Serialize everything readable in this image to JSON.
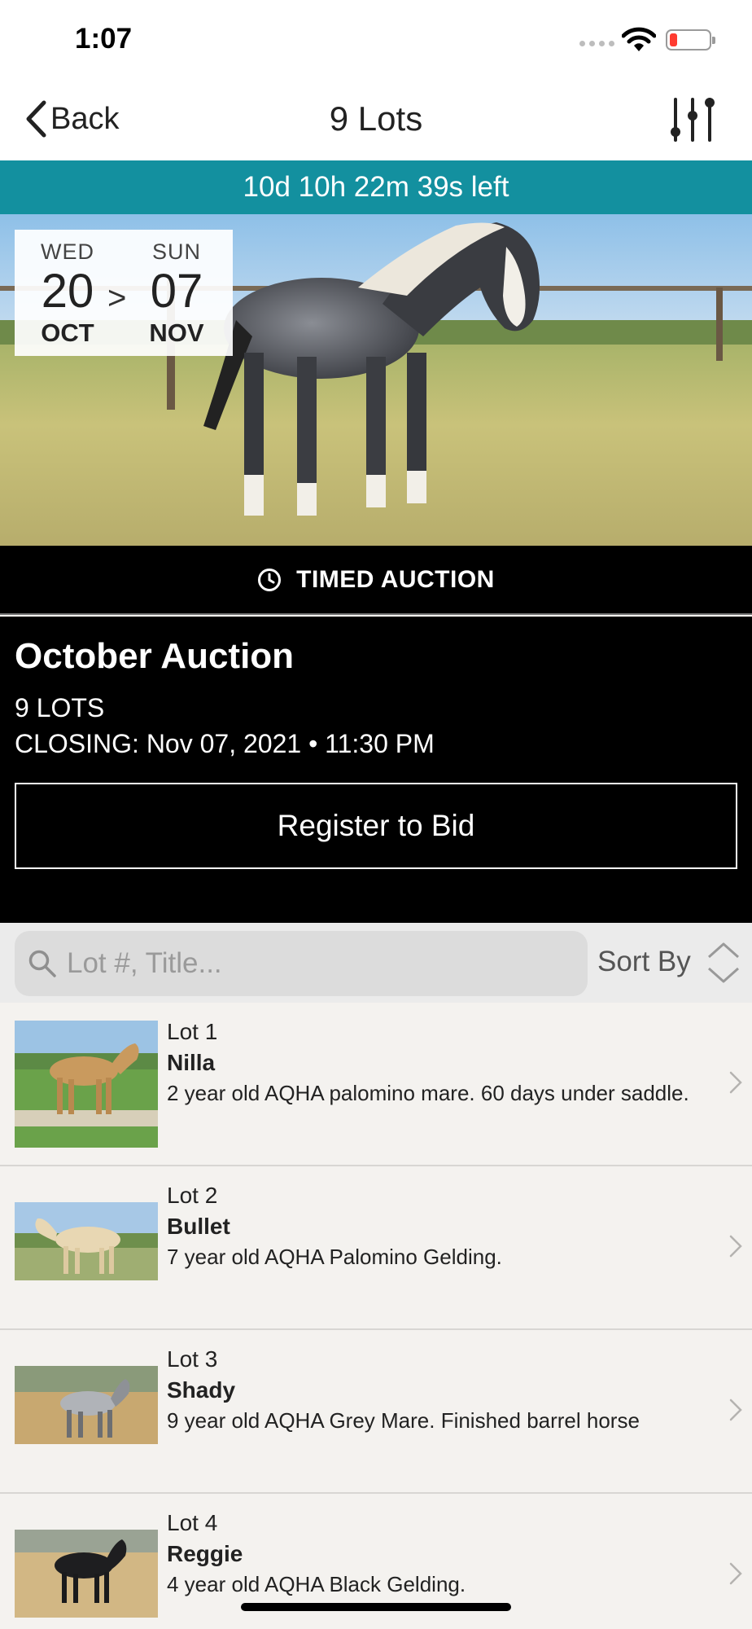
{
  "status_bar": {
    "time": "1:07"
  },
  "nav": {
    "back_label": "Back",
    "title": "9 Lots"
  },
  "countdown": "10d 10h 22m 39s left",
  "dates": {
    "start": {
      "dow": "WED",
      "day": "20",
      "month": "OCT"
    },
    "separator": ">",
    "end": {
      "dow": "SUN",
      "day": "07",
      "month": "NOV"
    }
  },
  "auction": {
    "type_label": "TIMED AUCTION",
    "title": "October Auction",
    "lots_count": "9 LOTS",
    "closing": "CLOSING: Nov 07, 2021 • 11:30 PM",
    "register_label": "Register to Bid"
  },
  "search": {
    "placeholder": "Lot #, Title...",
    "sort_label": "Sort By"
  },
  "lots": [
    {
      "number": "Lot 1",
      "name": "Nilla",
      "description": "2 year old AQHA palomino mare. 60 days under saddle."
    },
    {
      "number": "Lot 2",
      "name": "Bullet",
      "description": "7 year old AQHA Palomino Gelding."
    },
    {
      "number": "Lot 3",
      "name": "Shady",
      "description": "9 year old AQHA Grey Mare. Finished barrel horse"
    },
    {
      "number": "Lot 4",
      "name": "Reggie",
      "description": "4 year old AQHA Black Gelding."
    }
  ],
  "colors": {
    "countdown_bg": "#13909f",
    "section_bg": "#000000",
    "list_bg": "#f4f2ef"
  }
}
